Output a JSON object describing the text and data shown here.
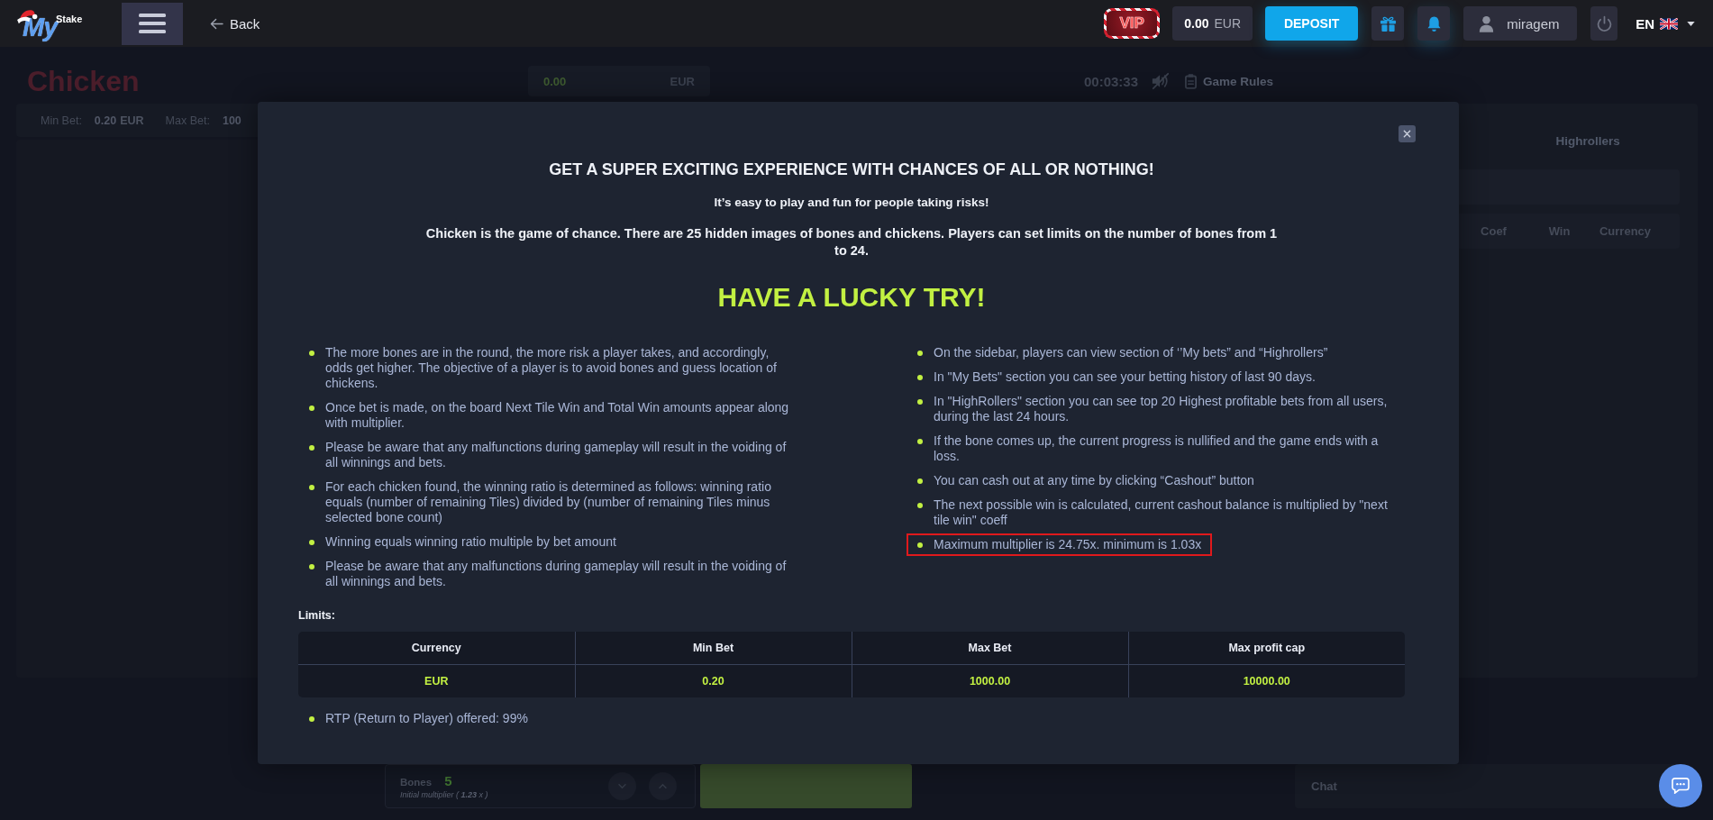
{
  "header": {
    "logo": {
      "script": "My",
      "word": "Stake"
    },
    "back_label": "Back",
    "vip_label": "VIP",
    "balance": {
      "amount": "0.00",
      "currency": "EUR"
    },
    "deposit_label": "DEPOSIT",
    "username": "miragem",
    "language": "EN"
  },
  "game": {
    "title": "Chicken",
    "bet_field": {
      "amount": "0.00",
      "currency": "EUR"
    },
    "timer": "00:03:33",
    "sound_muted": true,
    "rules_link": "Game Rules",
    "limits": [
      {
        "label": "Min Bet:",
        "value": "0.20",
        "unit": "EUR"
      },
      {
        "label": "Max Bet:",
        "value": "100"
      }
    ],
    "bones": {
      "label": "Bones",
      "value": "5",
      "note": "Initial multiplier ( **1.23** x )"
    }
  },
  "sidebar": {
    "tabs": [
      {
        "label": "Highrollers",
        "selected": false
      }
    ],
    "columns": [
      "Coef",
      "Win",
      "Currency"
    ],
    "chat_label": "Chat"
  },
  "modal": {
    "title": "GET A SUPER EXCITING EXPERIENCE WITH CHANCES OF ALL OR NOTHING!",
    "subtitle": "It’s easy to play and fun for people taking risks!",
    "intro": "Chicken is the game of chance. There are 25 hidden images of bones and chickens. Players can set limits on the number of bones from 1 to 24.",
    "slogan": "HAVE A LUCKY TRY!",
    "rules_left": [
      {
        "text": "The more bones are in the round, the more risk a player takes, and accordingly, odds get higher. The objective of a player is to avoid bones and guess location of chickens.",
        "highlighted": false
      },
      {
        "text": "Once bet is made, on the board Next Tile Win and Total Win amounts appear along with multiplier.",
        "highlighted": false
      },
      {
        "text": "Please be aware that any malfunctions during gameplay will result in the voiding of all winnings and bets.",
        "highlighted": false
      },
      {
        "text": "For each chicken found, the winning ratio is determined as follows: winning ratio equals (number of remaining Tiles) divided by (number of remaining Tiles minus selected bone count)",
        "highlighted": false
      },
      {
        "text": "Winning equals winning ratio multiple by bet amount",
        "highlighted": false
      },
      {
        "text": "Please be aware that any malfunctions during gameplay will result in the voiding of all winnings and bets.",
        "highlighted": false
      }
    ],
    "rules_right": [
      {
        "text": "On the sidebar, players can view section of ‘’My bets” and “Highrollers”",
        "highlighted": false
      },
      {
        "text": "In \"My Bets\" section you can see your betting history of last 90 days.",
        "highlighted": false
      },
      {
        "text": "In \"HighRollers\" section you can see top 20 Highest profitable bets from all users, during the last 24 hours.",
        "highlighted": false
      },
      {
        "text": "If the bone comes up, the current progress is nullified and the game ends with a loss.",
        "highlighted": false
      },
      {
        "text": "You can cash out at any time by clicking “Cashout” button",
        "highlighted": false
      },
      {
        "text": "The next possible win is calculated, current cashout balance is multiplied by \"next tile win\" coeff",
        "highlighted": false
      },
      {
        "text": "Maximum multiplier is 24.75x. minimum is 1.03x",
        "highlighted": true
      }
    ],
    "limits_label": "Limits:",
    "limits_table": {
      "columns": [
        "Currency",
        "Min Bet",
        "Max Bet",
        "Max profit cap"
      ],
      "rows": [
        [
          "EUR",
          "0.20",
          "1000.00",
          "10000.00"
        ]
      ]
    },
    "footnotes": [
      {
        "text": "RTP (Return to Player) offered: 99%",
        "highlighted": false
      }
    ]
  }
}
